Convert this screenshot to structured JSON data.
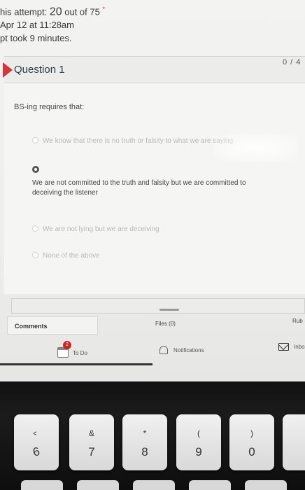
{
  "attempt": {
    "score_prefix": "his attempt: ",
    "score_value": "20",
    "score_suffix": " out of 75",
    "required_mark": "*",
    "submitted": "Apr 12 at 11:28am",
    "duration": "pt took 9 minutes."
  },
  "question": {
    "title": "Question 1",
    "points": "0 / 4",
    "text": "BS-ing requires that:",
    "answers": [
      {
        "text": "We know that there is no truth or falsity to what we are saying",
        "selected": false
      },
      {
        "text": "We are not committed to the truth and falsity but we are committed to deceiving the listener",
        "selected": true
      },
      {
        "text": "We are not lying but we are deceiving",
        "selected": false
      },
      {
        "text": "None of the above",
        "selected": false
      }
    ]
  },
  "tabs": {
    "comments": "Comments",
    "files": "Files (0)",
    "rubric": "Rub"
  },
  "bottom_nav": {
    "todo": {
      "label": "To Do",
      "badge": "2"
    },
    "notifications": {
      "label": "Notifications"
    },
    "inbox": {
      "label": "Inbo"
    }
  },
  "keyboard": {
    "keys": [
      {
        "top": "^",
        "bottom": "6"
      },
      {
        "top": "&",
        "bottom": "7"
      },
      {
        "top": "*",
        "bottom": "8"
      },
      {
        "top": "(",
        "bottom": "9"
      },
      {
        "top": ")",
        "bottom": "0"
      },
      {
        "top": "",
        "bottom": ""
      }
    ]
  },
  "colors": {
    "flag": "#d8343b",
    "badge": "#c62828"
  }
}
